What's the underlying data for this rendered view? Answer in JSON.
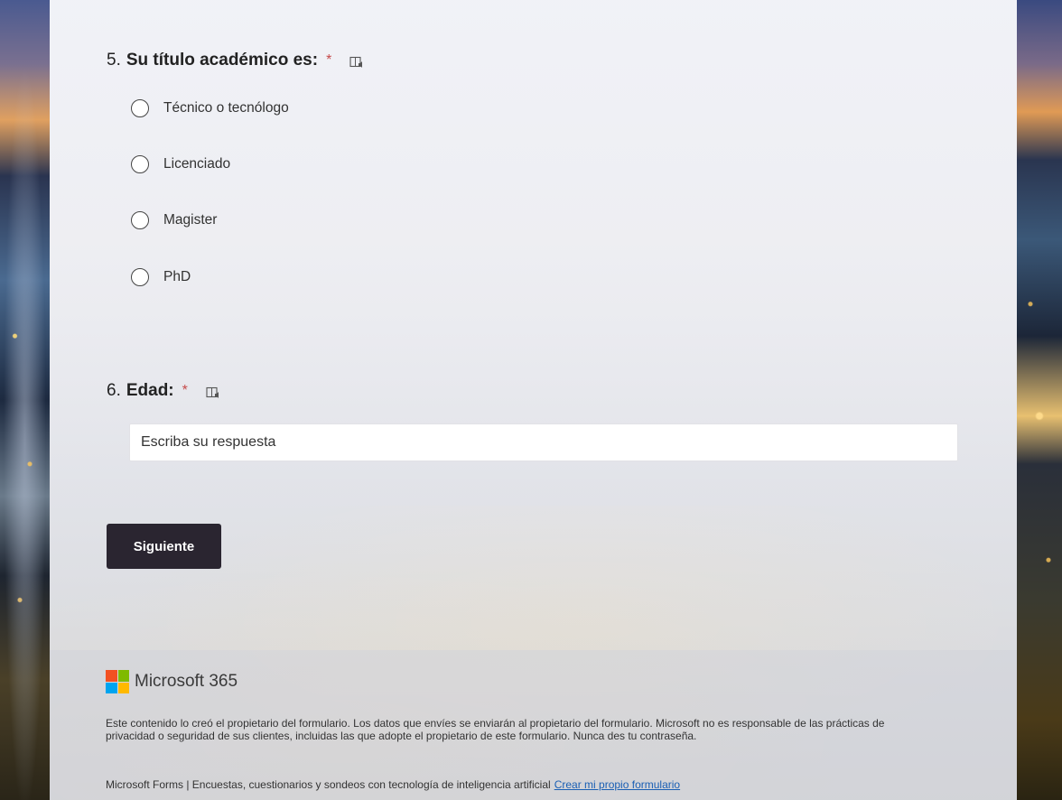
{
  "question5": {
    "number": "5.",
    "title": "Su título académico es:",
    "required_mark": "*",
    "reader_icon": "immersive-reader-icon",
    "options": [
      "Técnico o tecnólogo",
      "Licenciado",
      "Magister",
      "PhD"
    ]
  },
  "question6": {
    "number": "6.",
    "title": "Edad:",
    "required_mark": "*",
    "reader_icon": "immersive-reader-icon",
    "placeholder": "Escriba su respuesta"
  },
  "buttons": {
    "next_label": "Siguiente"
  },
  "footer": {
    "brand": "Microsoft 365",
    "disclaimer": "Este contenido lo creó el propietario del formulario. Los datos que envíes se enviarán al propietario del formulario. Microsoft no es responsable de las prácticas de privacidad o seguridad de sus clientes, incluidas las que adopte el propietario de este formulario. Nunca des tu contraseña.",
    "tagline": "Microsoft Forms | Encuestas, cuestionarios y sondeos con tecnología de inteligencia artificial",
    "create_link": "Crear mi propio formulario"
  },
  "colors": {
    "required": "#c64b4b",
    "button_bg": "#2a2530",
    "link": "#1a5fb4"
  }
}
